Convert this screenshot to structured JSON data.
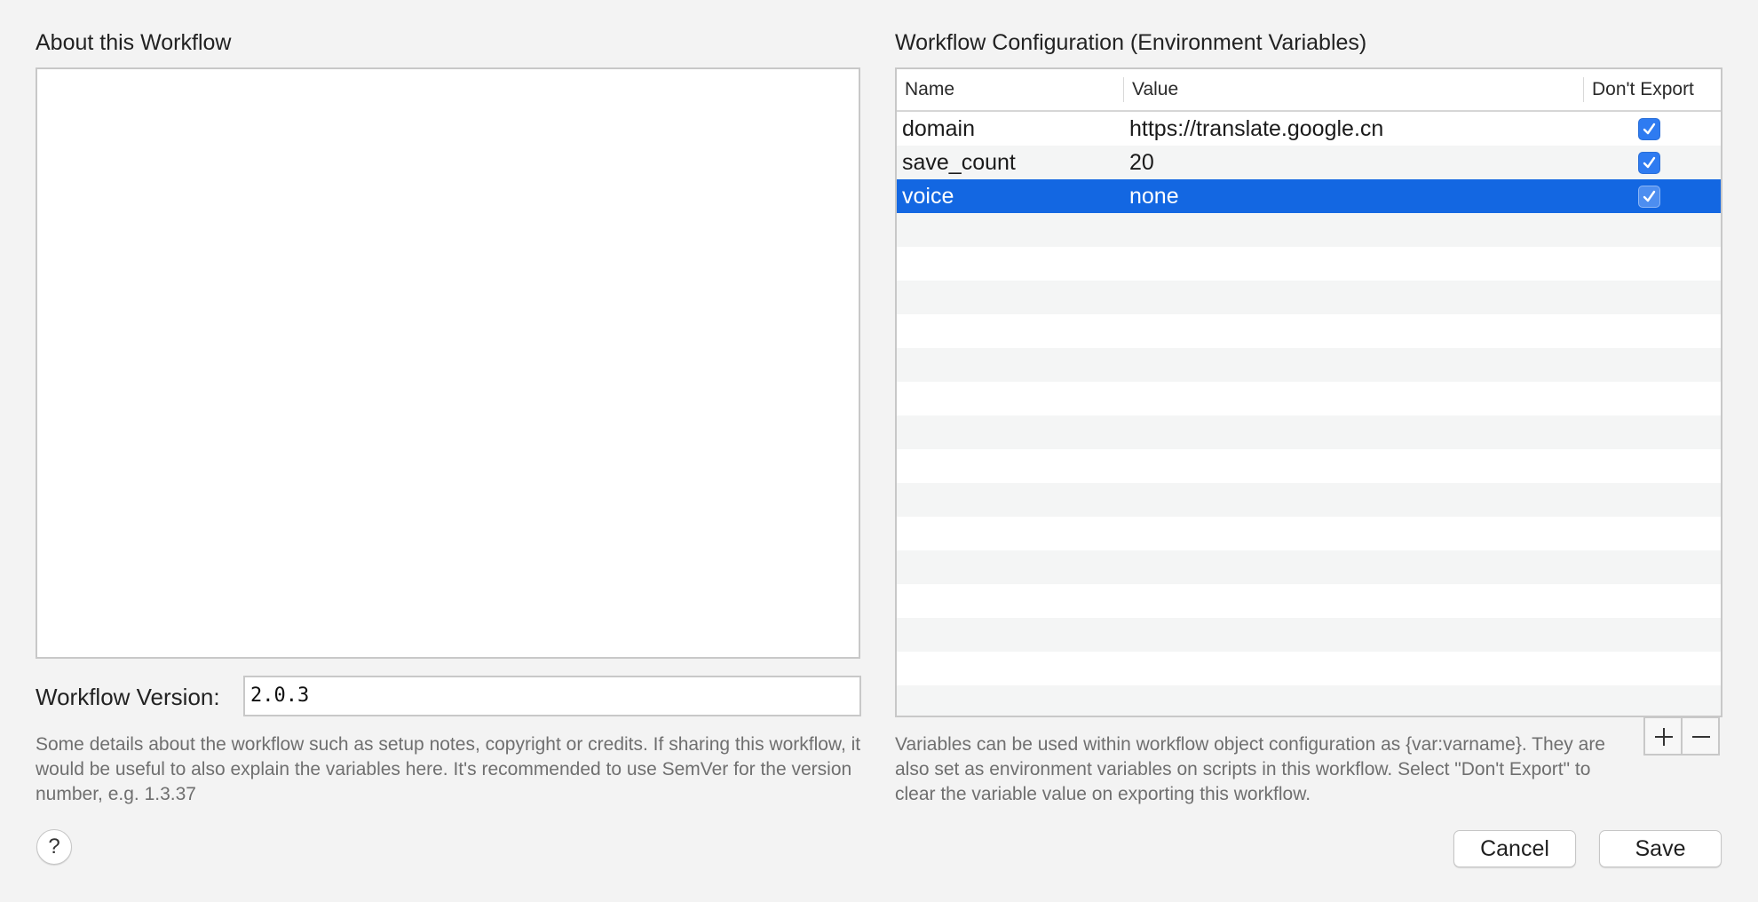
{
  "about": {
    "title": "About this Workflow",
    "text": "",
    "version_label": "Workflow Version:",
    "version_value": "2.0.3",
    "help_text": "Some details about the workflow such as setup notes, copyright or credits. If sharing this workflow, it would be useful to also explain the variables here. It's recommended to use SemVer for the version number, e.g. 1.3.37"
  },
  "config": {
    "title": "Workflow Configuration (Environment Variables)",
    "columns": [
      "Name",
      "Value",
      "Don't Export"
    ],
    "rows": [
      {
        "name": "domain",
        "value": "https://translate.google.cn",
        "dont_export": true
      },
      {
        "name": "save_count",
        "value": "20",
        "dont_export": true
      },
      {
        "name": "voice",
        "value": "none",
        "dont_export": true
      }
    ],
    "selected_row": 2,
    "add_icon": "plus-icon",
    "remove_icon": "minus-icon",
    "help_text": "Variables can be used within workflow object configuration as {var:varname}. They are also set as environment variables on scripts in this workflow. Select \"Don't Export\" to clear the variable value on exporting this workflow."
  },
  "buttons": {
    "help_label": "?",
    "cancel_label": "Cancel",
    "save_label": "Save"
  },
  "colors": {
    "selection": "#1367e2",
    "checkbox": "#2e7bf1",
    "background": "#f3f3f3"
  }
}
